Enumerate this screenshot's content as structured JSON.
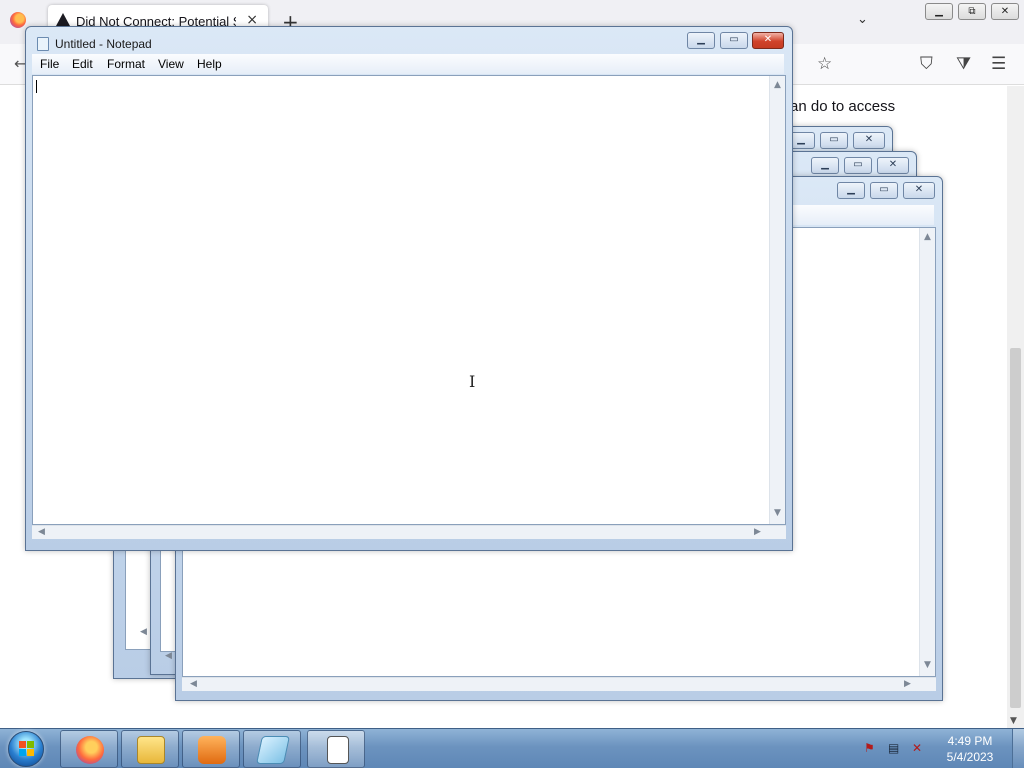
{
  "browser": {
    "tab_title": "Did Not Connect: Potential Security Issue",
    "tab_close": "×",
    "new_tab": "+",
    "list_tabs": "⌄",
    "back": "←",
    "content_text": "an do to access",
    "window_buttons": {
      "minimize": "▁",
      "restore": "⧉",
      "close": "✕"
    },
    "nav_icons": {
      "bookmark": "☆",
      "pocket": "⛉",
      "extensions": "⧩",
      "menu": "☰"
    }
  },
  "notepad": {
    "title": "Untitled - Notepad",
    "menu": [
      "File",
      "Edit",
      "Format",
      "View",
      "Help"
    ],
    "text": "",
    "title_buttons": {
      "minimize": "▁",
      "maximize": "▭",
      "close": "✕"
    }
  },
  "scroll_arrows": {
    "up": "▲",
    "down": "▼",
    "left": "◀",
    "right": "▶"
  },
  "taskbar": {
    "pinned": [
      "firefox-icon",
      "explorer-icon",
      "media-player-icon",
      "notepad-icon",
      "open-window-icon"
    ],
    "clock_time": "4:49 PM",
    "clock_date": "5/4/2023",
    "tray_icons": [
      "action-center-icon",
      "network-icon",
      "volume-muted-icon"
    ]
  },
  "colors": {
    "accent": "#5e87b6",
    "close": "#c53b22",
    "frame": "#c3d6ec"
  }
}
